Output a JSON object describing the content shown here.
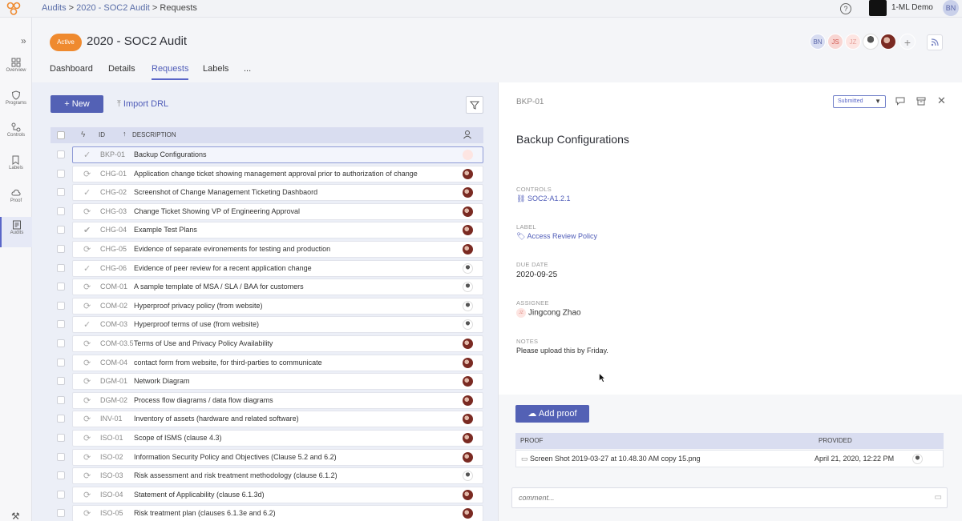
{
  "topbar": {
    "breadcrumb": [
      "Audits",
      "2020 - SOC2 Audit",
      "Requests"
    ],
    "help_icon": "?",
    "org_name": "1-ML Demo",
    "user_initials": "BN"
  },
  "rail": {
    "items": [
      {
        "label": "Overview",
        "icon": "overview-icon"
      },
      {
        "label": "Programs",
        "icon": "shield-icon"
      },
      {
        "label": "Controls",
        "icon": "controls-icon"
      },
      {
        "label": "Labels",
        "icon": "label-icon"
      },
      {
        "label": "Proof",
        "icon": "cloud-icon"
      },
      {
        "label": "Audits",
        "icon": "audit-icon"
      }
    ]
  },
  "header": {
    "status_badge": "Active",
    "title": "2020 - SOC2 Audit",
    "members": [
      "BN",
      "JS",
      "JZ"
    ],
    "add_member": "+"
  },
  "tabs": [
    "Dashboard",
    "Details",
    "Requests",
    "Labels",
    "..."
  ],
  "list": {
    "new_button": "New",
    "import_button": "Import DRL",
    "columns": {
      "id": "ID",
      "description": "DESCRIPTION"
    },
    "rows": [
      {
        "id": "BKP-01",
        "description": "Backup Configurations",
        "status": "check",
        "avatar": "jz"
      },
      {
        "id": "CHG-01",
        "description": "Application change ticket showing management approval prior to authorization of change",
        "status": "sync",
        "avatar": "dark"
      },
      {
        "id": "CHG-02",
        "description": "Screenshot of Change Management Ticketing Dashbaord",
        "status": "check",
        "avatar": "dark"
      },
      {
        "id": "CHG-03",
        "description": "Change Ticket Showing VP of Engineering Approval",
        "status": "sync",
        "avatar": "dark"
      },
      {
        "id": "CHG-04",
        "description": "Example Test Plans",
        "status": "double-check",
        "avatar": "dark"
      },
      {
        "id": "CHG-05",
        "description": "Evidence of separate evironements for testing and production",
        "status": "sync",
        "avatar": "dark"
      },
      {
        "id": "CHG-06",
        "description": "Evidence of peer review for a recent application change",
        "status": "check",
        "avatar": "person"
      },
      {
        "id": "COM-01",
        "description": "A sample template of MSA / SLA / BAA for customers",
        "status": "sync",
        "avatar": "person"
      },
      {
        "id": "COM-02",
        "description": "Hyperproof privacy policy (from website)",
        "status": "sync",
        "avatar": "person"
      },
      {
        "id": "COM-03",
        "description": "Hyperproof terms of use (from website)",
        "status": "check",
        "avatar": "person"
      },
      {
        "id": "COM-03.5",
        "description": "Terms of Use and Privacy Policy Availability",
        "status": "sync",
        "avatar": "dark"
      },
      {
        "id": "COM-04",
        "description": "contact form from website, for third-parties to communicate",
        "status": "sync",
        "avatar": "dark"
      },
      {
        "id": "DGM-01",
        "description": "Network Diagram",
        "status": "sync",
        "avatar": "dark"
      },
      {
        "id": "DGM-02",
        "description": "Process flow diagrams / data flow diagrams",
        "status": "sync",
        "avatar": "dark"
      },
      {
        "id": "INV-01",
        "description": "Inventory of assets (hardware and related software)",
        "status": "sync",
        "avatar": "dark"
      },
      {
        "id": "ISO-01",
        "description": "Scope of ISMS (clause 4.3)",
        "status": "sync",
        "avatar": "dark"
      },
      {
        "id": "ISO-02",
        "description": "Information Security Policy and Objectives (Clause 5.2 and 6.2)",
        "status": "sync",
        "avatar": "dark"
      },
      {
        "id": "ISO-03",
        "description": "Risk assessment and risk treatment methodology (clause 6.1.2)",
        "status": "sync",
        "avatar": "person"
      },
      {
        "id": "ISO-04",
        "description": "Statement of Applicability (clause 6.1.3d)",
        "status": "sync",
        "avatar": "dark"
      },
      {
        "id": "ISO-05",
        "description": "Risk treatment plan (clauses 6.1.3e and 6.2)",
        "status": "sync",
        "avatar": "dark"
      }
    ]
  },
  "detail": {
    "id": "BKP-01",
    "status": "Submitted",
    "title": "Backup Configurations",
    "controls_label": "CONTROLS",
    "controls_value": "SOC2-A1.2.1",
    "label_label": "LABEL",
    "label_value": "Access Review Policy",
    "due_label": "DUE DATE",
    "due_value": "2020-09-25",
    "assignee_label": "ASSIGNEE",
    "assignee_initials": "JZ",
    "assignee_value": "Jingcong Zhao",
    "notes_label": "NOTES",
    "notes_value": "Please upload this by Friday.",
    "add_proof": "Add proof",
    "proof_columns": {
      "proof": "PROOF",
      "provided": "PROVIDED"
    },
    "proof_file": "Screen Shot 2019-03-27 at 10.48.30 AM copy 15.png",
    "proof_date": "April 21, 2020, 12:22 PM",
    "comment_placeholder": "comment..."
  }
}
